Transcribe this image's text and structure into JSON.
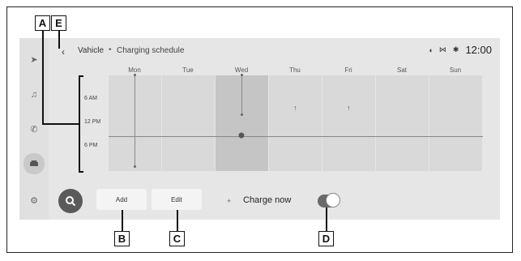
{
  "callouts": {
    "a": "A",
    "b": "B",
    "c": "C",
    "d": "D",
    "e": "E"
  },
  "header": {
    "back_icon": "chevron-left-icon",
    "crumb_1": "Vahicle",
    "crumb_sep": "•",
    "crumb_2": "Charging schedule",
    "status_icons": [
      "mic-off-icon",
      "signal-icon",
      "bluetooth-icon"
    ],
    "time": "12:00"
  },
  "sidebar": {
    "items": [
      {
        "name": "navigation-icon",
        "glyph": "➤"
      },
      {
        "name": "music-icon",
        "glyph": "♫"
      },
      {
        "name": "phone-icon",
        "glyph": "✆"
      },
      {
        "name": "vehicle-icon",
        "glyph": "🚘"
      },
      {
        "name": "settings-icon",
        "glyph": "⚙"
      }
    ],
    "active_index": 3
  },
  "schedule": {
    "days": [
      "Mon",
      "Tue",
      "Wed",
      "Thu",
      "Fri",
      "Sat",
      "Sun"
    ],
    "selected_day": "Wed",
    "times": [
      "6 AM",
      "12 PM",
      "6 PM"
    ]
  },
  "actions": {
    "search_icon": "search-icon",
    "add_label": "Add",
    "edit_label": "Edit",
    "charge_plus": "+",
    "charge_label": "Charge now",
    "charge_toggle_on": true
  }
}
